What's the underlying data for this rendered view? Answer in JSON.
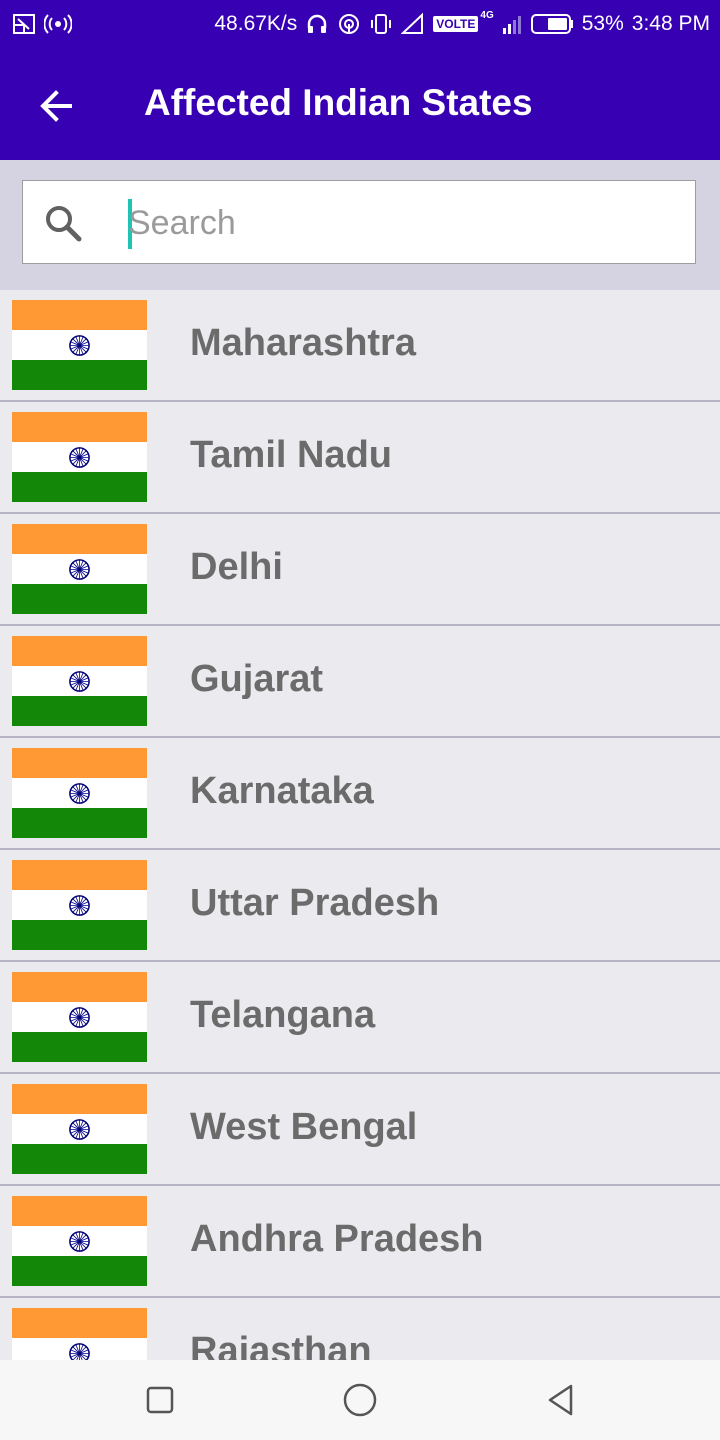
{
  "status_bar": {
    "network_speed": "48.67K/s",
    "volte": "VOLTE",
    "network_type": "4G",
    "battery": "53%",
    "time": "3:48 PM"
  },
  "app_bar": {
    "title": "Affected Indian States"
  },
  "search": {
    "placeholder": "Search",
    "value": ""
  },
  "states": [
    {
      "name": "Maharashtra"
    },
    {
      "name": "Tamil Nadu"
    },
    {
      "name": "Delhi"
    },
    {
      "name": "Gujarat"
    },
    {
      "name": "Karnataka"
    },
    {
      "name": "Uttar Pradesh"
    },
    {
      "name": "Telangana"
    },
    {
      "name": "West Bengal"
    },
    {
      "name": "Andhra Pradesh"
    },
    {
      "name": "Rajasthan"
    }
  ],
  "colors": {
    "app_bar": "#3700b3",
    "search_area": "#d5d2e1",
    "list_background": "#ebeaee",
    "flag_saffron": "#ff9933",
    "flag_green": "#138808",
    "chakra": "#000080",
    "cursor": "#1fc4b5"
  },
  "icons": {
    "back": "arrow-back-icon",
    "search": "search-icon",
    "nav_recents": "square-icon",
    "nav_home": "circle-icon",
    "nav_back": "triangle-back-icon"
  }
}
